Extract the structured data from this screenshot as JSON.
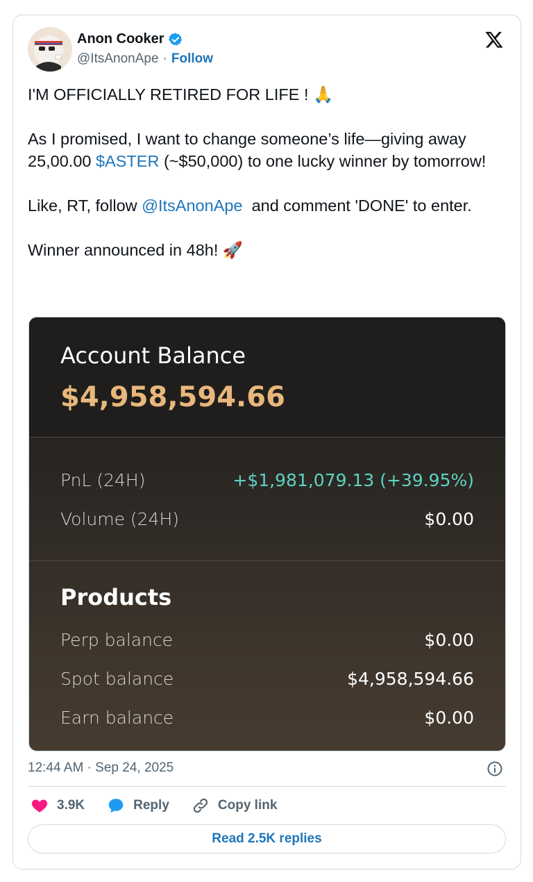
{
  "author": {
    "display_name": "Anon Cooker",
    "handle": "@ItsAnonApe",
    "follow_label": "Follow",
    "separator": "·"
  },
  "tweet": {
    "line1": "I'M OFFICIALLY RETIRED FOR LIFE ! 🙏",
    "para2_before": "As I promised, I want to change someone’s life—giving away 25,00.00 ",
    "para2_cashtag": "$ASTER",
    "para2_after": " (~$50,000) to one lucky winner by tomorrow!",
    "para3_before": "Like, RT, follow ",
    "para3_mention": "@ItsAnonApe",
    "para3_after": "  and comment 'DONE' to enter.",
    "para4": "Winner announced in 48h! 🚀"
  },
  "media": {
    "account_title": "Account Balance",
    "account_value": "$4,958,594.66",
    "pnl_label": "PnL (24H)",
    "pnl_value": "+$1,981,079.13 (+39.95%)",
    "volume_label": "Volume (24H)",
    "volume_value": "$0.00",
    "products_title": "Products",
    "perp_label": "Perp balance",
    "perp_value": "$0.00",
    "spot_label": "Spot balance",
    "spot_value": "$4,958,594.66",
    "earn_label": "Earn balance",
    "earn_value": "$0.00"
  },
  "footer": {
    "timestamp": "12:44 AM · Sep 24, 2025",
    "likes": "3.9K",
    "reply_label": "Reply",
    "copy_link_label": "Copy link",
    "read_replies_label": "Read 2.5K replies"
  },
  "colors": {
    "link_blue": "#1d75bb",
    "verified_blue": "#1d9bf0",
    "heart_pink": "#f91880",
    "balance_gold": "#e8b77c",
    "pnl_teal": "#5ed2c3"
  },
  "icons": [
    "verified-badge-icon",
    "x-logo-icon",
    "info-icon",
    "heart-icon",
    "reply-icon",
    "link-icon"
  ]
}
